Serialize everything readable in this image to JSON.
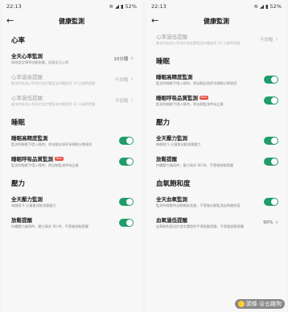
{
  "status": {
    "time": "22:13",
    "battery": "52%"
  },
  "left": {
    "title": "健康監測",
    "sections": [
      {
        "heading": "心率",
        "rows": [
          {
            "title": "全天心率監測",
            "desc": "按照設定頻率自動測量，記錄全天心率",
            "value": "10分鐘",
            "type": "chevron",
            "dim": false
          },
          {
            "title": "心率過高提醒",
            "desc": "靜坐時檢測心率高於設定閾值並持續超過 10 分鐘時提醒",
            "value": "不提醒",
            "type": "chevron",
            "dim": true
          },
          {
            "title": "心率過低提醒",
            "desc": "靜坐時檢測心率低於設定閾值並持續超過 10 分鐘時提醒",
            "value": "不提醒",
            "type": "chevron",
            "dim": true
          }
        ]
      },
      {
        "heading": "睡眠",
        "rows": [
          {
            "title": "睡眠高精度監測",
            "desc": "監測到睡眠手環入睡時，將自動記錄更多睡眠分期資訊",
            "type": "toggle"
          },
          {
            "title": "睡眠呼吸品質監測",
            "badge": "New",
            "desc": "監測到睡眠手環入睡時，將自動監測呼吸品質",
            "type": "toggle"
          }
        ]
      },
      {
        "heading": "壓力",
        "rows": [
          {
            "title": "全天壓力監測",
            "desc": "每間隔 5 分鐘會自動測量壓力",
            "type": "toggle"
          },
          {
            "title": "放鬆提醒",
            "desc": "持續壓力偏高時，壓力高於 80 時，手環會振動提醒",
            "type": "toggle"
          }
        ]
      }
    ]
  },
  "right": {
    "title": "健康監測",
    "top_row": {
      "title": "心率過低提醒",
      "desc": "靜坐時檢測心率低於設定閾值並持續超過 10 分鐘時提醒",
      "value": "不提醒",
      "dim": true
    },
    "sections": [
      {
        "heading": "睡眠",
        "rows": [
          {
            "title": "睡眠高精度監測",
            "desc": "監測到睡眠手環入睡時，將自動記錄更多睡眠分期資訊",
            "type": "toggle"
          },
          {
            "title": "睡眠呼吸品質監測",
            "badge": "New",
            "desc": "監測到睡眠手環入睡時，將自動監測呼吸品質",
            "type": "toggle"
          }
        ]
      },
      {
        "heading": "壓力",
        "rows": [
          {
            "title": "全天壓力監測",
            "desc": "每間隔 5 分鐘會自動測量壓力",
            "type": "toggle"
          },
          {
            "title": "放鬆提醒",
            "desc": "持續壓力偏高時，壓力高於 80 時，手環會振動提醒",
            "type": "toggle"
          }
        ]
      },
      {
        "heading": "血氧飽和度",
        "rows": [
          {
            "title": "全天血氧監測",
            "desc": "監測到睡眠時自動開始測量，手環會自動監測血氧飽和度",
            "type": "toggle"
          },
          {
            "title": "血氧過低提醒",
            "desc": "血氧飽和度低於設定閾值時手環振動提醒，手環會振動提醒",
            "value": "90%",
            "type": "chevron"
          }
        ]
      }
    ]
  },
  "watermark": "頭條 @五趣狗"
}
